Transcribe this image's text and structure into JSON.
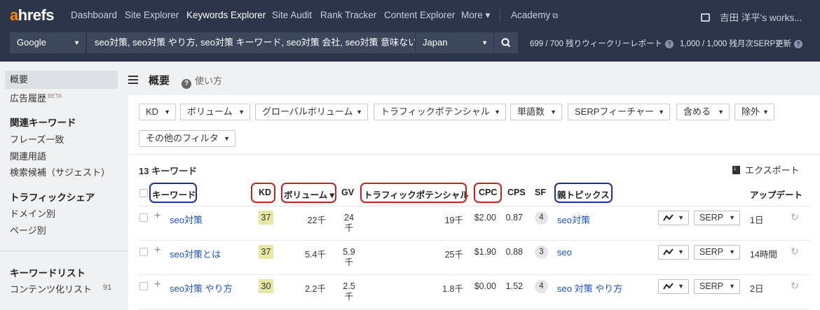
{
  "nav": {
    "logo_a": "a",
    "logo_rest": "hrefs",
    "items": [
      "Dashboard",
      "Site Explorer",
      "Keywords Explorer",
      "Site Audit",
      "Rank Tracker",
      "Content Explorer",
      "More ▾",
      "Academy"
    ],
    "workspace": "吉田 洋平's works..."
  },
  "search": {
    "engine": "Google",
    "keywords": "seo対策, seo対策 やり方, seo対策 キーワード, seo対策 会社, seo対策 意味ない",
    "country": "Japan",
    "weekly_reports": "699 / 700 残りウィークリーレポート",
    "serp_updates": "1,000 / 1,000 残月次SERP更新"
  },
  "sidebar": {
    "overview": "概要",
    "ads_history": "広告履歴",
    "beta": "BETA",
    "related_head": "関連キーワード",
    "phrase_match": "フレーズ一致",
    "related_terms": "関連用語",
    "suggestions": "検索候補（サジェスト）",
    "traffic_head": "トラフィックシェア",
    "by_domain": "ドメイン別",
    "by_page": "ページ別",
    "lists_head": "キーワードリスト",
    "content_list": "コンテンツ化リスト",
    "content_count": "91"
  },
  "header": {
    "title": "概要",
    "how_to": "使い方"
  },
  "filters": [
    "KD",
    "ボリューム",
    "グローバルボリューム",
    "トラフィックポテンシャル",
    "単語数",
    "SERPフィーチャー",
    "含める",
    "除外",
    "その他のフィルタ"
  ],
  "table": {
    "count": "13 キーワード",
    "export": "エクスポート",
    "headers": {
      "keyword": "キーワード",
      "kd": "KD",
      "volume": "ボリューム ▾",
      "gv": "GV",
      "traffic_potential": "トラフィックポテンシャル",
      "cpc": "CPC",
      "cps": "CPS",
      "sf": "SF",
      "parent_topic": "親トピックス",
      "update": "アップデート"
    },
    "ring_colors": {
      "red": "#cc1f1f",
      "blue": "#1a2fb0"
    },
    "rows": [
      {
        "keyword": "seo対策",
        "kd": "37",
        "volume": "22千",
        "gv1": "24",
        "gv2": "千",
        "tp": "19千",
        "cpc": "$2.00",
        "cps": "0.87",
        "sf": "4",
        "parent": "seo対策",
        "serp": "SERP",
        "update": "1日"
      },
      {
        "keyword": "seo対策とは",
        "kd": "37",
        "volume": "5.4千",
        "gv1": "5.9",
        "gv2": "千",
        "tp": "25千",
        "cpc": "$1.90",
        "cps": "0.88",
        "sf": "3",
        "parent": "seo",
        "serp": "SERP",
        "update": "14時間"
      },
      {
        "keyword": "seo対策 やり方",
        "kd": "30",
        "volume": "2.2千",
        "gv1": "2.5",
        "gv2": "千",
        "tp": "1.8千",
        "cpc": "$0.00",
        "cps": "1.52",
        "sf": "4",
        "parent": "seo 対策 やり方",
        "serp": "SERP",
        "update": "2日"
      }
    ]
  }
}
